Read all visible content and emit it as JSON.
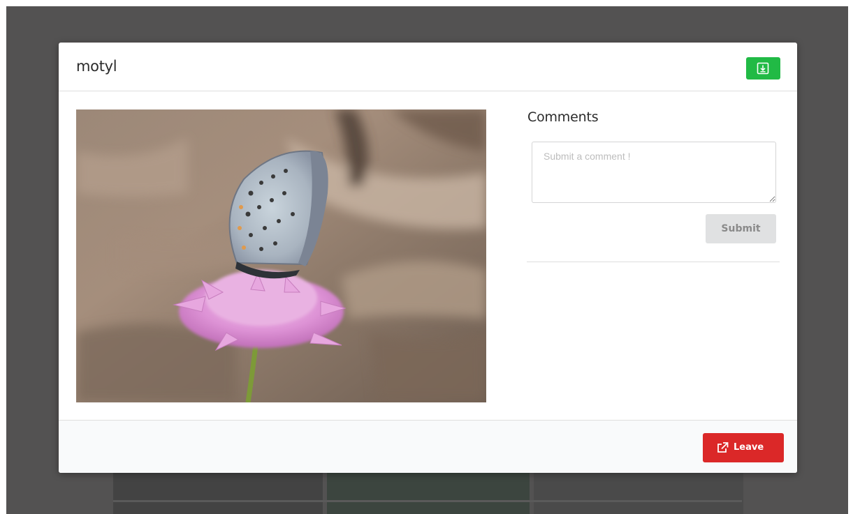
{
  "modal": {
    "title": "motyl",
    "download_icon": "download-icon",
    "image_alt": "butterfly on a pink flower",
    "comments": {
      "heading": "Comments",
      "input_placeholder": "Submit a comment !",
      "input_value": "",
      "submit_label": "Submit"
    },
    "footer": {
      "leave_label": "Leave",
      "leave_icon": "external-link-icon"
    }
  },
  "colors": {
    "download_button": "#21ba45",
    "leave_button": "#db2828",
    "submit_button": "#e0e1e2",
    "backdrop": "#535252"
  }
}
